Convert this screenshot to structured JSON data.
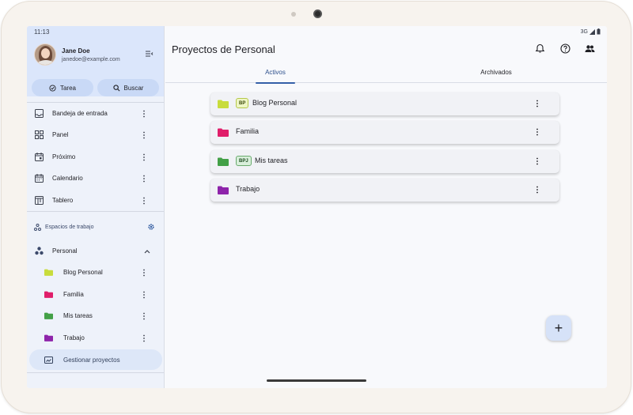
{
  "status": {
    "time": "11:13",
    "network": "3G"
  },
  "user": {
    "name": "Jane Doe",
    "email": "janedoe@example.com"
  },
  "actions": {
    "task_label": "Tarea",
    "search_label": "Buscar"
  },
  "nav": [
    {
      "label": "Bandeja de entrada",
      "icon": "inbox-icon"
    },
    {
      "label": "Panel",
      "icon": "dashboard-icon"
    },
    {
      "label": "Próximo",
      "icon": "calendar-upcoming-icon"
    },
    {
      "label": "Calendario",
      "icon": "calendar-icon"
    },
    {
      "label": "Tablero",
      "icon": "board-icon"
    }
  ],
  "workspaces": {
    "title": "Espacios de trabajo",
    "current": "Personal",
    "projects": [
      {
        "label": "Blog Personal",
        "color": "#c8dc3c"
      },
      {
        "label": "Familia",
        "color": "#e01e6a"
      },
      {
        "label": "Mis tareas",
        "color": "#43a047"
      },
      {
        "label": "Trabajo",
        "color": "#8e24aa"
      }
    ],
    "manage_label": "Gestionar proyectos"
  },
  "main": {
    "title": "Proyectos de Personal",
    "tabs": [
      {
        "label": "Activos",
        "active": true
      },
      {
        "label": "Archivados",
        "active": false
      }
    ],
    "cards": [
      {
        "title": "Blog Personal",
        "badge": "BP",
        "color": "#c8dc3c",
        "badge_bg": "#eef6c4",
        "badge_border": "#b6c84a"
      },
      {
        "title": "Familia",
        "badge": "",
        "color": "#e01e6a"
      },
      {
        "title": "Mis tareas",
        "badge": "BPJ",
        "color": "#43a047",
        "badge_bg": "#d9efdb",
        "badge_border": "#6aaa6e"
      },
      {
        "title": "Trabajo",
        "badge": "",
        "color": "#8e24aa"
      }
    ],
    "fab_label": "+"
  }
}
